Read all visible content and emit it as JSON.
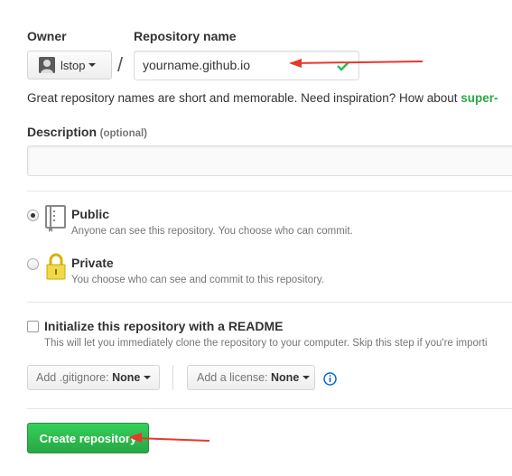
{
  "owner": {
    "label": "Owner",
    "username": "lstop"
  },
  "separator": "/",
  "repo_name": {
    "label": "Repository name",
    "value": "yourname.github.io"
  },
  "hint": {
    "prefix": "Great repository names are short and memorable. Need inspiration? How about ",
    "suggestion": "super-"
  },
  "description": {
    "label": "Description",
    "optional": "(optional)",
    "value": ""
  },
  "visibility": {
    "public": {
      "title": "Public",
      "desc": "Anyone can see this repository. You choose who can commit."
    },
    "private": {
      "title": "Private",
      "desc": "You choose who can see and commit to this repository."
    }
  },
  "readme": {
    "label": "Initialize this repository with a README",
    "desc": "This will let you immediately clone the repository to your computer. Skip this step if you're importi"
  },
  "gitignore": {
    "prefix": "Add .gitignore:",
    "value": "None"
  },
  "license": {
    "prefix": "Add a license:",
    "value": "None"
  },
  "create_button": "Create repository",
  "colors": {
    "accent_green": "#28a745",
    "arrow_red": "#e8382a",
    "info_blue": "#0366d6"
  }
}
